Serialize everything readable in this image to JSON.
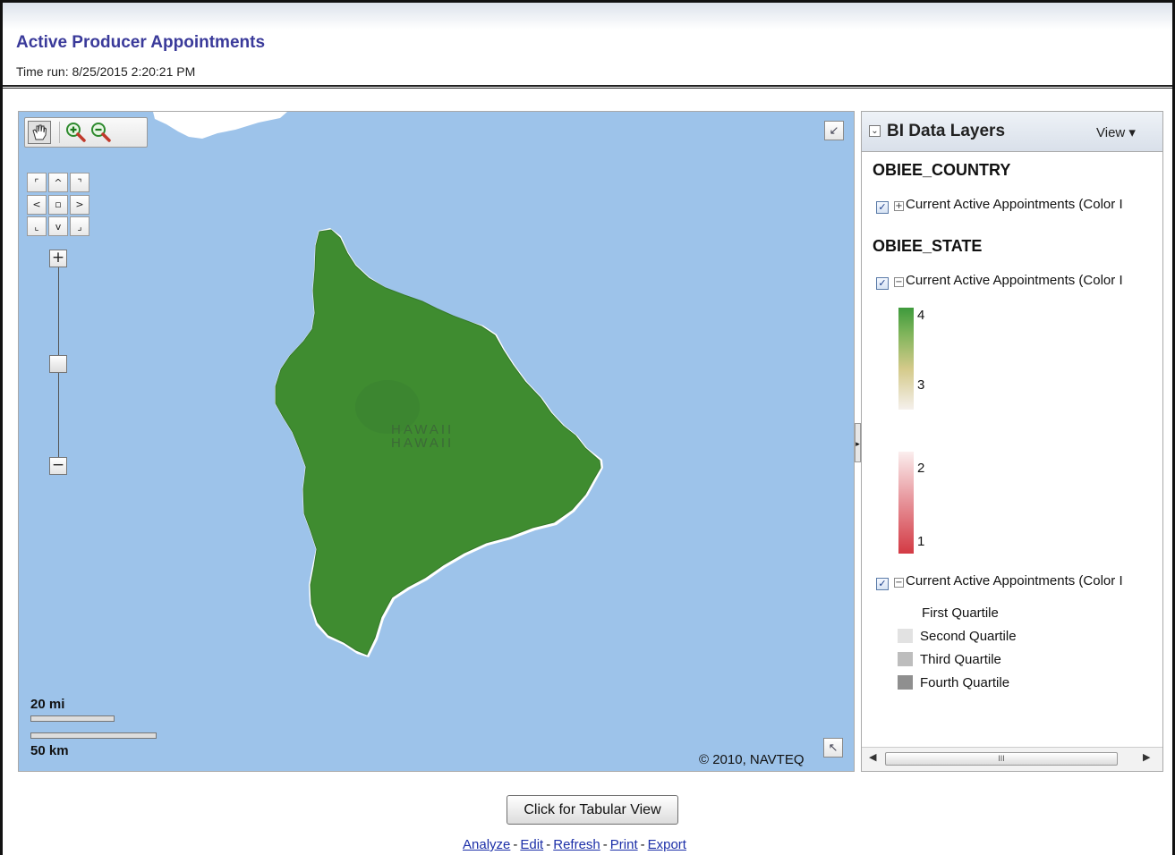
{
  "report": {
    "title": "Active Producer Appointments",
    "time_run": "Time run: 8/25/2015 2:20:21 PM"
  },
  "map": {
    "island_label_1": "HAWAII",
    "island_label_2": "HAWAII",
    "scale_miles": "20 mi",
    "scale_km": "50 km",
    "copyright": "© 2010, NAVTEQ",
    "colors": {
      "water": "#9dc3ea",
      "land": "#3f8c30",
      "shore": "#ffffff"
    },
    "toolbar_icons": [
      "pan-hand-icon",
      "zoom-in-icon",
      "zoom-out-icon"
    ],
    "pan_arrows": [
      "⌜",
      "^",
      "⌝",
      "<",
      "▫",
      ">",
      "⌞",
      "v",
      "⌟"
    ],
    "zoom_plus": "+",
    "zoom_minus": "−"
  },
  "legend": {
    "title": "BI Data Layers",
    "view_menu": "View ▾",
    "group_country": "OBIEE_COUNTRY",
    "group_state": "OBIEE_STATE",
    "layer_country": "Current Active Appointments (Color I",
    "layer_state_1": "Current Active Appointments (Color I",
    "layer_state_2": "Current Active Appointments (Color I",
    "ramp_labels": [
      "4",
      "3",
      "2",
      "1"
    ],
    "quartiles": [
      {
        "label": "First Quartile",
        "color": "#ffffff"
      },
      {
        "label": "Second Quartile",
        "color": "#e2e2e2"
      },
      {
        "label": "Third Quartile",
        "color": "#bdbdbd"
      },
      {
        "label": "Fourth Quartile",
        "color": "#8f8f8f"
      }
    ],
    "scroll_grip": "III"
  },
  "footer": {
    "tabular_button": "Click for Tabular View",
    "links": [
      "Analyze",
      "Edit",
      "Refresh",
      "Print",
      "Export"
    ],
    "separator": "-"
  }
}
